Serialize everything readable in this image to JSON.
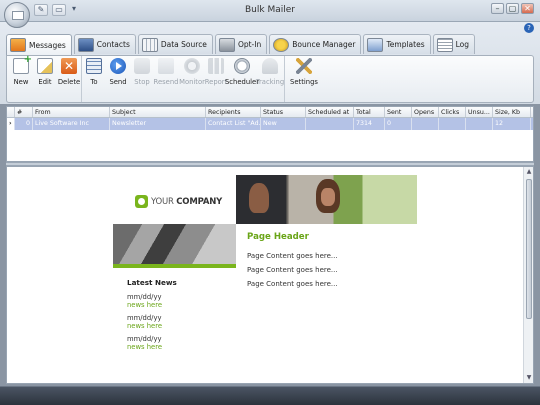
{
  "window": {
    "title": "Bulk Mailer",
    "qat": [
      "save-icon",
      "open-icon"
    ],
    "controls": [
      "minimize-icon",
      "restore-icon",
      "close-icon"
    ]
  },
  "tabs": [
    {
      "label": "Messages",
      "icon": "messages-icon",
      "active": true
    },
    {
      "label": "Contacts",
      "icon": "contacts-icon"
    },
    {
      "label": "Data Source",
      "icon": "data-source-icon"
    },
    {
      "label": "Opt-In",
      "icon": "opt-in-icon"
    },
    {
      "label": "Bounce Manager",
      "icon": "bounce-manager-icon"
    },
    {
      "label": "Templates",
      "icon": "templates-icon"
    },
    {
      "label": "Log",
      "icon": "log-icon"
    }
  ],
  "toolbar": {
    "new": "New",
    "edit": "Edit",
    "delete": "Delete",
    "to": "To",
    "send": "Send",
    "stop": "Stop",
    "resend": "Resend",
    "monitor": "Monitor",
    "report": "Report",
    "scheduler": "Scheduler",
    "tracking": "Tracking",
    "settings": "Settings"
  },
  "grid": {
    "columns": [
      "#",
      "From",
      "Subject",
      "Recipients",
      "Status",
      "Scheduled at",
      "Total",
      "Sent",
      "Opens",
      "Clicks",
      "Unsu...",
      "Size, Kb"
    ],
    "rows": [
      {
        "num": "0",
        "from": "Live Software Inc",
        "subject": "Newsletter",
        "recipients": "Contact List \"Ad...",
        "status": "New",
        "scheduled": "",
        "total": "7314",
        "sent": "0",
        "opens": "",
        "clicks": "",
        "unsub": "",
        "size": "12"
      }
    ]
  },
  "preview": {
    "brand_your": "YOUR",
    "brand_company": "COMPANY",
    "page_header": "Page Header",
    "content_lines": [
      "Page Content goes here...",
      "Page Content goes here...",
      "Page Content goes here..."
    ],
    "latest_news": "Latest News",
    "news": [
      {
        "date": "mm/dd/yy",
        "text": "news here"
      },
      {
        "date": "mm/dd/yy",
        "text": "news here"
      },
      {
        "date": "mm/dd/yy",
        "text": "news here"
      }
    ]
  }
}
